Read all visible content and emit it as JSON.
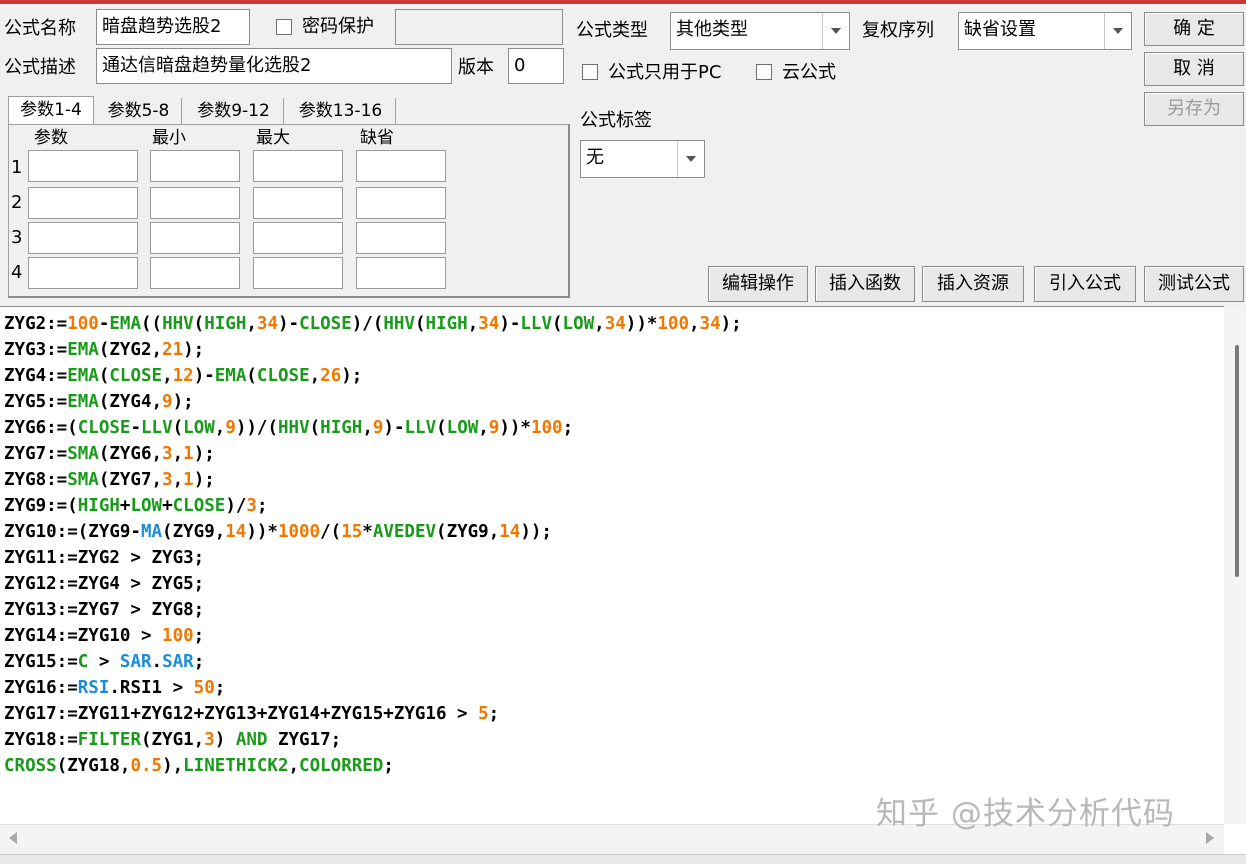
{
  "form": {
    "name_label": "公式名称",
    "name_value": "暗盘趋势选股2",
    "password_label": "密码保护",
    "password_checked": false,
    "password_value": "",
    "desc_label": "公式描述",
    "desc_value": "通达信暗盘趋势量化选股2",
    "version_label": "版本",
    "version_value": "0",
    "type_label": "公式类型",
    "type_value": "其他类型",
    "fq_label": "复权序列",
    "fq_value": "缺省设置",
    "pc_only_label": "公式只用于PC",
    "pc_only_checked": false,
    "cloud_label": "云公式",
    "cloud_checked": false,
    "tag_label": "公式标签",
    "tag_value": "无"
  },
  "buttons": {
    "ok": "确 定",
    "cancel": "取 消",
    "save_as": "另存为",
    "edit_ops": "编辑操作",
    "insert_func": "插入函数",
    "insert_res": "插入资源",
    "import_formula": "引入公式",
    "test_formula": "测试公式"
  },
  "tabs": [
    {
      "label": "参数1-4",
      "active": true
    },
    {
      "label": "参数5-8",
      "active": false
    },
    {
      "label": "参数9-12",
      "active": false
    },
    {
      "label": "参数13-16",
      "active": false
    }
  ],
  "params": {
    "headers": [
      "参数",
      "最小",
      "最大",
      "缺省"
    ],
    "rows": [
      "1",
      "2",
      "3",
      "4"
    ]
  },
  "code_lines": [
    [
      [
        "ZYG2:=",
        ""
      ],
      [
        "100",
        "n"
      ],
      [
        "-",
        ""
      ],
      [
        "EMA",
        "g"
      ],
      [
        "((",
        ""
      ],
      [
        "HHV",
        "g"
      ],
      [
        "(",
        ""
      ],
      [
        "HIGH",
        "g"
      ],
      [
        ",",
        ""
      ],
      [
        "34",
        "n"
      ],
      [
        ")-",
        ""
      ],
      [
        "CLOSE",
        "g"
      ],
      [
        ")/(",
        ""
      ],
      [
        "HHV",
        "g"
      ],
      [
        "(",
        ""
      ],
      [
        "HIGH",
        "g"
      ],
      [
        ",",
        ""
      ],
      [
        "34",
        "n"
      ],
      [
        ")-",
        ""
      ],
      [
        "LLV",
        "g"
      ],
      [
        "(",
        ""
      ],
      [
        "LOW",
        "g"
      ],
      [
        ",",
        ""
      ],
      [
        "34",
        "n"
      ],
      [
        "))*",
        ""
      ],
      [
        "100",
        "n"
      ],
      [
        ",",
        ""
      ],
      [
        "34",
        "n"
      ],
      [
        ");",
        ""
      ]
    ],
    [
      [
        "ZYG3:=",
        ""
      ],
      [
        "EMA",
        "g"
      ],
      [
        "(ZYG2,",
        ""
      ],
      [
        "21",
        "n"
      ],
      [
        ");",
        ""
      ]
    ],
    [
      [
        "ZYG4:=",
        ""
      ],
      [
        "EMA",
        "g"
      ],
      [
        "(",
        ""
      ],
      [
        "CLOSE",
        "g"
      ],
      [
        ",",
        ""
      ],
      [
        "12",
        "n"
      ],
      [
        ")-",
        ""
      ],
      [
        "EMA",
        "g"
      ],
      [
        "(",
        ""
      ],
      [
        "CLOSE",
        "g"
      ],
      [
        ",",
        ""
      ],
      [
        "26",
        "n"
      ],
      [
        ");",
        ""
      ]
    ],
    [
      [
        "ZYG5:=",
        ""
      ],
      [
        "EMA",
        "g"
      ],
      [
        "(ZYG4,",
        ""
      ],
      [
        "9",
        "n"
      ],
      [
        ");",
        ""
      ]
    ],
    [
      [
        "ZYG6:=(",
        ""
      ],
      [
        "CLOSE",
        "g"
      ],
      [
        "-",
        ""
      ],
      [
        "LLV",
        "g"
      ],
      [
        "(",
        ""
      ],
      [
        "LOW",
        "g"
      ],
      [
        ",",
        ""
      ],
      [
        "9",
        "n"
      ],
      [
        "))/(",
        ""
      ],
      [
        "HHV",
        "g"
      ],
      [
        "(",
        ""
      ],
      [
        "HIGH",
        "g"
      ],
      [
        ",",
        ""
      ],
      [
        "9",
        "n"
      ],
      [
        ")-",
        ""
      ],
      [
        "LLV",
        "g"
      ],
      [
        "(",
        ""
      ],
      [
        "LOW",
        "g"
      ],
      [
        ",",
        ""
      ],
      [
        "9",
        "n"
      ],
      [
        "))*",
        ""
      ],
      [
        "100",
        "n"
      ],
      [
        ";",
        ""
      ]
    ],
    [
      [
        "ZYG7:=",
        ""
      ],
      [
        "SMA",
        "g"
      ],
      [
        "(ZYG6,",
        ""
      ],
      [
        "3",
        "n"
      ],
      [
        ",",
        ""
      ],
      [
        "1",
        "n"
      ],
      [
        ");",
        ""
      ]
    ],
    [
      [
        "ZYG8:=",
        ""
      ],
      [
        "SMA",
        "g"
      ],
      [
        "(ZYG7,",
        ""
      ],
      [
        "3",
        "n"
      ],
      [
        ",",
        ""
      ],
      [
        "1",
        "n"
      ],
      [
        ");",
        ""
      ]
    ],
    [
      [
        "ZYG9:=(",
        ""
      ],
      [
        "HIGH",
        "g"
      ],
      [
        "+",
        ""
      ],
      [
        "LOW",
        "g"
      ],
      [
        "+",
        ""
      ],
      [
        "CLOSE",
        "g"
      ],
      [
        ")/",
        ""
      ],
      [
        "3",
        "n"
      ],
      [
        ";",
        ""
      ]
    ],
    [
      [
        "ZYG10:=(ZYG9-",
        ""
      ],
      [
        "MA",
        "b"
      ],
      [
        "(ZYG9,",
        ""
      ],
      [
        "14",
        "n"
      ],
      [
        "))*",
        ""
      ],
      [
        "1000",
        "n"
      ],
      [
        "/(",
        ""
      ],
      [
        "15",
        "n"
      ],
      [
        "*",
        ""
      ],
      [
        "AVEDEV",
        "g"
      ],
      [
        "(ZYG9,",
        ""
      ],
      [
        "14",
        "n"
      ],
      [
        "));",
        ""
      ]
    ],
    [
      [
        "ZYG11:=ZYG2 > ZYG3;",
        ""
      ]
    ],
    [
      [
        "ZYG12:=ZYG4 > ZYG5;",
        ""
      ]
    ],
    [
      [
        "ZYG13:=ZYG7 > ZYG8;",
        ""
      ]
    ],
    [
      [
        "ZYG14:=ZYG10 > ",
        ""
      ],
      [
        "100",
        "n"
      ],
      [
        ";",
        ""
      ]
    ],
    [
      [
        "ZYG15:=",
        ""
      ],
      [
        "C",
        "g"
      ],
      [
        " > ",
        ""
      ],
      [
        "SAR",
        "b"
      ],
      [
        ".",
        ""
      ],
      [
        "SAR",
        "b"
      ],
      [
        ";",
        ""
      ]
    ],
    [
      [
        "ZYG16:=",
        ""
      ],
      [
        "RSI",
        "b"
      ],
      [
        ".RSI1 > ",
        ""
      ],
      [
        "50",
        "n"
      ],
      [
        ";",
        ""
      ]
    ],
    [
      [
        "ZYG17:=ZYG11+ZYG12+ZYG13+ZYG14+ZYG15+ZYG16 > ",
        ""
      ],
      [
        "5",
        "n"
      ],
      [
        ";",
        ""
      ]
    ],
    [
      [
        "ZYG18:=",
        ""
      ],
      [
        "FILTER",
        "g"
      ],
      [
        "(ZYG1,",
        ""
      ],
      [
        "3",
        "n"
      ],
      [
        ") ",
        ""
      ],
      [
        "AND",
        "g"
      ],
      [
        " ZYG17;",
        ""
      ]
    ],
    [
      [
        "CROSS",
        "g"
      ],
      [
        "(ZYG18,",
        ""
      ],
      [
        "0.5",
        "n"
      ],
      [
        "),",
        ""
      ],
      [
        "LINETHICK2",
        "g"
      ],
      [
        ",",
        ""
      ],
      [
        "COLORRED",
        "g"
      ],
      [
        ";",
        ""
      ]
    ]
  ],
  "watermark": "知乎 @技术分析代码"
}
